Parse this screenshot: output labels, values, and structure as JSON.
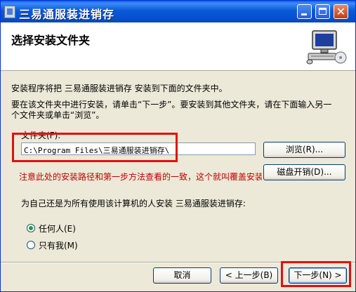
{
  "window": {
    "title": "三易通服装进销存",
    "close_glyph": "✕"
  },
  "header": {
    "title": "选择安装文件夹",
    "icon": "computer-icon"
  },
  "body": {
    "line1": "安装程序将把 三易通服装进销存 安装到下面的文件夹中。",
    "line2": "要在该文件夹中进行安装，请单击“下一步”。要安装到其他文件夹，请在下面输入另一",
    "line3": "个文件夹或单击“浏览”。",
    "folder_label": "文件夹(F):",
    "folder_value": "C:\\Program Files\\三易通服装进销存\\",
    "browse_label": "浏览(R)...",
    "disk_cost_label": "磁盘开销(D)...",
    "note": "注意此处的安装路径和第一步方法查看的一致，这个就叫覆盖安装。",
    "for_whom": "为自己还是为所有使用该计算机的人安装 三易通服装进销存:",
    "radio_everyone": "任何人(E)",
    "radio_just_me": "只有我(M)"
  },
  "footer": {
    "cancel_label": "取消",
    "back_label": "< 上一步(B)",
    "next_label": "下一步(N) >"
  },
  "colors": {
    "annotation_red": "#e01010",
    "titlebar_blue": "#0a5ad8"
  }
}
